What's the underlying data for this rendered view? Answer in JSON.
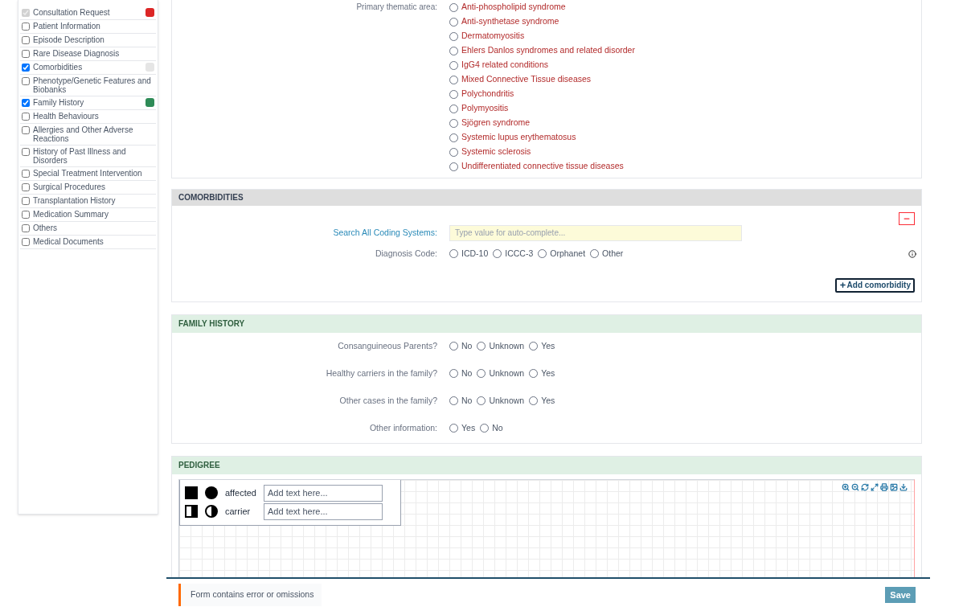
{
  "sidebar": {
    "items": [
      {
        "label": "Consultation Request",
        "checked": true,
        "disabled": true,
        "color": "#dc2626"
      },
      {
        "label": "Patient Information",
        "checked": false,
        "disabled": false
      },
      {
        "label": "Episode Description",
        "checked": false,
        "disabled": false
      },
      {
        "label": "Rare Disease Diagnosis",
        "checked": false,
        "disabled": false
      },
      {
        "label": "Comorbidities",
        "checked": true,
        "disabled": false,
        "color": "#e5e5e5"
      },
      {
        "label": "Phenotype/Genetic Features and Biobanks",
        "checked": false,
        "disabled": false
      },
      {
        "label": "Family History",
        "checked": true,
        "disabled": false,
        "color": "#2e8b57"
      },
      {
        "label": "Health Behaviours",
        "checked": false,
        "disabled": false
      },
      {
        "label": "Allergies and Other Adverse Reactions",
        "checked": false,
        "disabled": false
      },
      {
        "label": "History of Past Illness and Disorders",
        "checked": false,
        "disabled": false
      },
      {
        "label": "Special Treatment Intervention",
        "checked": false,
        "disabled": false
      },
      {
        "label": "Surgical Procedures",
        "checked": false,
        "disabled": false
      },
      {
        "label": "Transplantation History",
        "checked": false,
        "disabled": false
      },
      {
        "label": "Medication Summary",
        "checked": false,
        "disabled": false
      },
      {
        "label": "Others",
        "checked": false,
        "disabled": false
      },
      {
        "label": "Medical Documents",
        "checked": false,
        "disabled": false
      }
    ]
  },
  "thematic_area": {
    "label": "Primary thematic area:",
    "options": [
      {
        "label": "Anti-phospholipid syndrome",
        "selected": false
      },
      {
        "label": "Anti-synthetase syndrome",
        "selected": false
      },
      {
        "label": "Dermatomyositis",
        "selected": false
      },
      {
        "label": "Ehlers Danlos syndromes and related disorder",
        "selected": false
      },
      {
        "label": "IgG4 related conditions",
        "selected": false
      },
      {
        "label": "Mixed Connective Tissue diseases",
        "selected": false
      },
      {
        "label": "Polychondritis",
        "selected": false
      },
      {
        "label": "Polymyositis",
        "selected": false
      },
      {
        "label": "Sjögren syndrome",
        "selected": false
      },
      {
        "label": "Systemic lupus erythematosus",
        "selected": false
      },
      {
        "label": "Systemic sclerosis",
        "selected": false
      },
      {
        "label": "Undifferentiated connective tissue diseases",
        "selected": false
      }
    ]
  },
  "comorbidities": {
    "title": "COMORBIDITIES",
    "search_label": "Search All Coding Systems:",
    "search_placeholder": "Type value for auto-complete...",
    "code_label": "Diagnosis Code:",
    "code_options": [
      {
        "label": "ICD-10",
        "selected": false
      },
      {
        "label": "ICCC-3",
        "selected": false
      },
      {
        "label": "Orphanet",
        "selected": false
      },
      {
        "label": "Other",
        "selected": false
      }
    ],
    "add_button": "Add comorbidity"
  },
  "family_history": {
    "title": "FAMILY HISTORY",
    "questions": [
      {
        "label": "Consanguineous Parents?",
        "options": [
          {
            "label": "No",
            "selected": false
          },
          {
            "label": "Unknown",
            "selected": false
          },
          {
            "label": "Yes",
            "selected": false
          }
        ]
      },
      {
        "label": "Healthy carriers in the family?",
        "options": [
          {
            "label": "No",
            "selected": false
          },
          {
            "label": "Unknown",
            "selected": false
          },
          {
            "label": "Yes",
            "selected": false
          }
        ]
      },
      {
        "label": "Other cases in the family?",
        "options": [
          {
            "label": "No",
            "selected": false
          },
          {
            "label": "Unknown",
            "selected": false
          },
          {
            "label": "Yes",
            "selected": false
          }
        ]
      },
      {
        "label": "Other information:",
        "options": [
          {
            "label": "Yes",
            "selected": false
          },
          {
            "label": "No",
            "selected": false
          }
        ]
      }
    ]
  },
  "pedigree": {
    "title": "PEDIGREE",
    "legend": [
      {
        "kind": "affected",
        "label": "affected",
        "placeholder": "Add text here..."
      },
      {
        "kind": "carrier",
        "label": "carrier",
        "placeholder": "Add text here..."
      }
    ]
  },
  "footer": {
    "message": "Form contains error or omissions",
    "save": "Save"
  }
}
